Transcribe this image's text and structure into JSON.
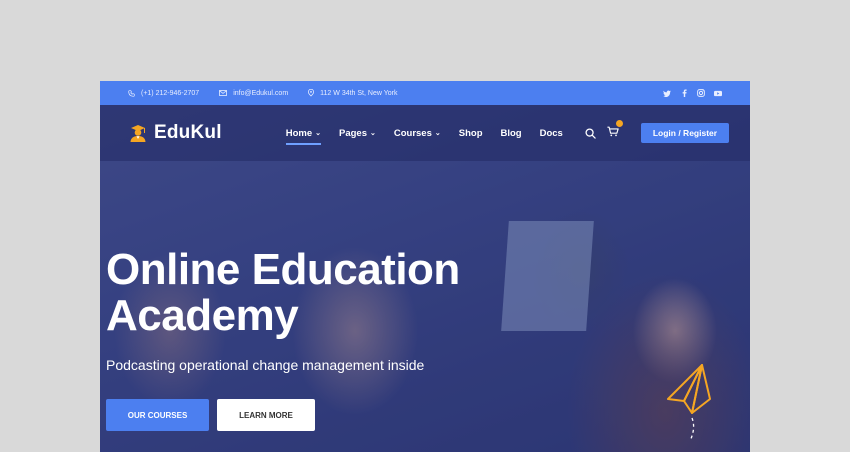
{
  "topbar": {
    "phone": "(+1) 212-946-2707",
    "email": "info@Edukul.com",
    "address": "112 W 34th St, New York",
    "social_icons": [
      "twitter-icon",
      "facebook-icon",
      "instagram-icon",
      "youtube-icon"
    ]
  },
  "nav": {
    "logo_text": "EduKul",
    "items": [
      {
        "label": "Home",
        "dropdown": true,
        "active": true
      },
      {
        "label": "Pages",
        "dropdown": true,
        "active": false
      },
      {
        "label": "Courses",
        "dropdown": true,
        "active": false
      },
      {
        "label": "Shop",
        "dropdown": false,
        "active": false
      },
      {
        "label": "Blog",
        "dropdown": false,
        "active": false
      },
      {
        "label": "Docs",
        "dropdown": false,
        "active": false
      }
    ],
    "login_label": "Login / Register"
  },
  "hero": {
    "title_line1": "Online Education",
    "title_line2": "Academy",
    "subtitle": "Podcasting operational change management inside",
    "primary_button": "OUR COURSES",
    "secondary_button": "LEARN MORE"
  },
  "colors": {
    "accent": "#4c7ff0",
    "logo_orange": "#f5a623",
    "hero_overlay": "#3a4680"
  }
}
